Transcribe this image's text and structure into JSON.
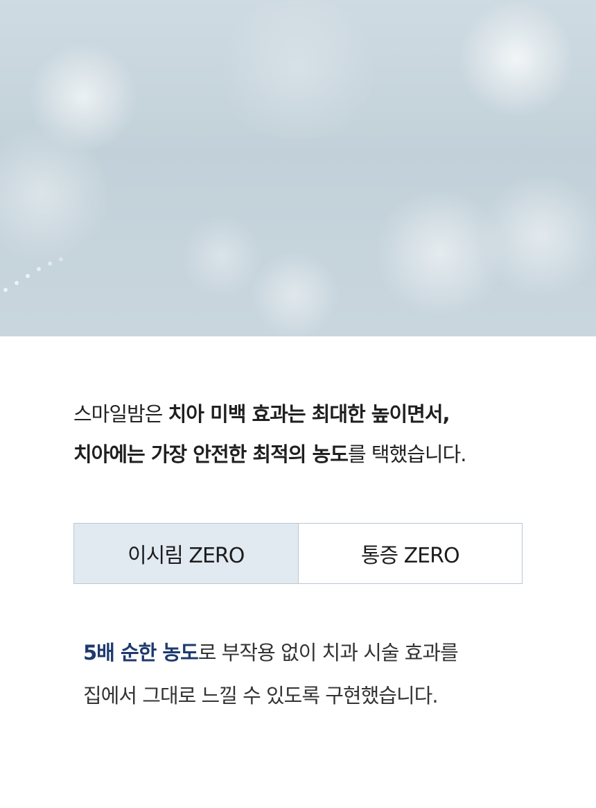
{
  "hero": {
    "image": "blurred light-blue bokeh background"
  },
  "intro": {
    "line1_plain": "스마일밤은 ",
    "line1_bold": "치아 미백 효과는 최대한 높이면서,",
    "line2_bold": "치아에는 가장 안전한 최적의 농도",
    "line2_plain": "를 택했습니다."
  },
  "tabs": [
    {
      "label": "이시림 ZERO",
      "selected": true
    },
    {
      "label": "통증 ZERO",
      "selected": false
    }
  ],
  "description": {
    "highlight": "5배 순한 농도",
    "line1_rest": "로 부작용 없이 치과 시술 효과를",
    "line2": "집에서 그대로 느낄 수 있도록 구현했습니다."
  },
  "colors": {
    "highlight": "#1e3a6e",
    "tab_active_bg": "#e1e9f1",
    "tab_border": "#b9c8d4"
  }
}
